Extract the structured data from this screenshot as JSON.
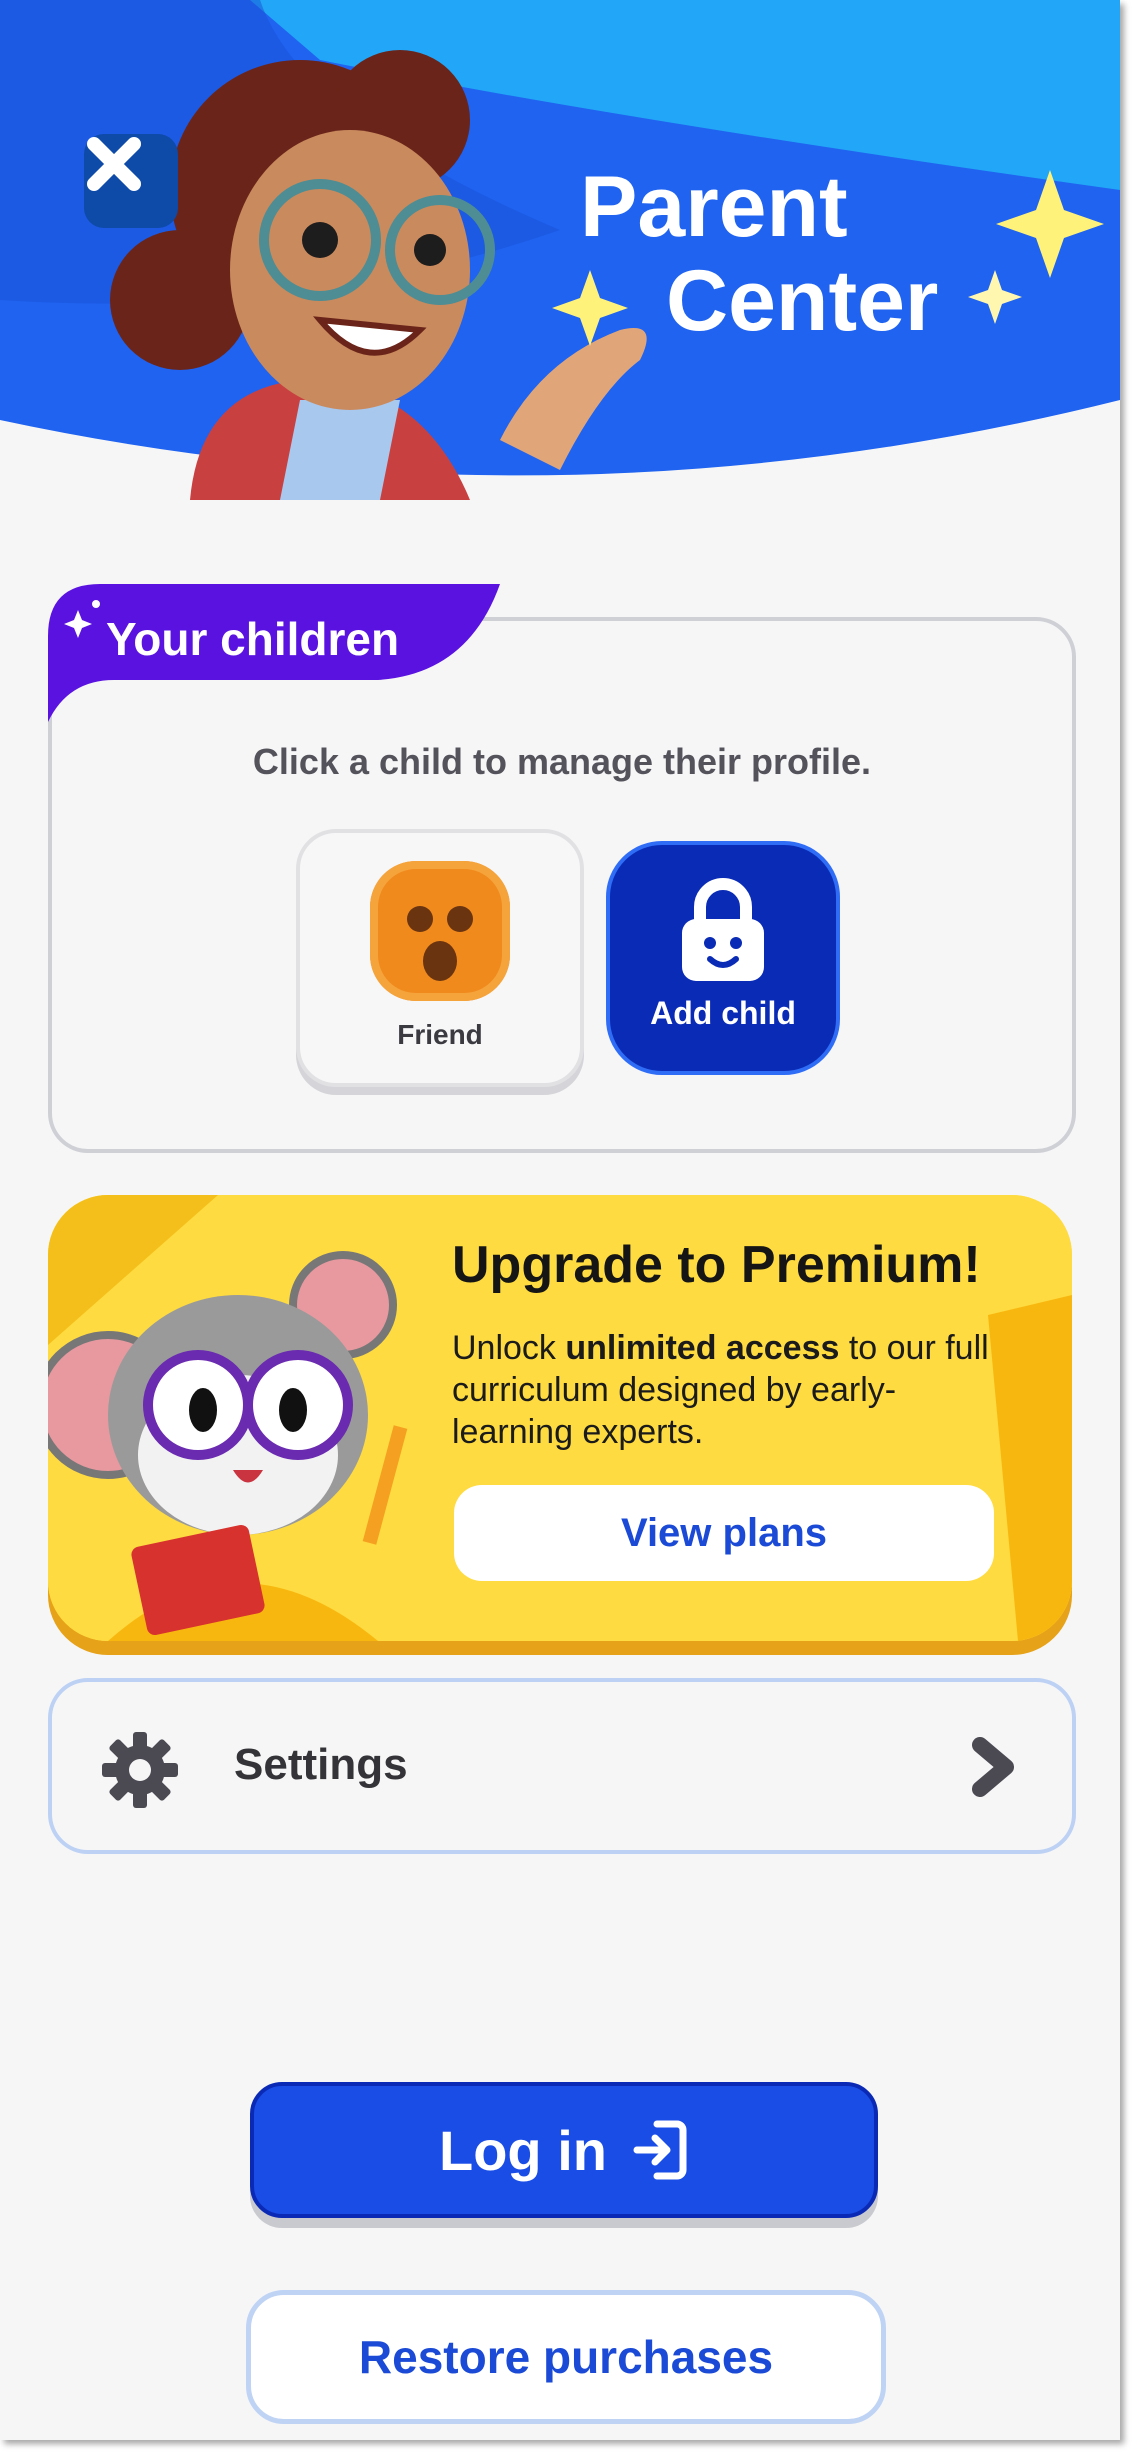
{
  "header": {
    "title_line1": "Parent",
    "title_line2": "Center",
    "close_icon": "close-icon",
    "colors": {
      "sky": "#1aa3f5",
      "blue": "#1f63f0"
    }
  },
  "children": {
    "tab_label": "Your children",
    "hint": "Click a child to manage their profile.",
    "profiles": [
      {
        "label": "Friend"
      }
    ],
    "add_child_label": "Add child",
    "colors": {
      "tab": "#5a12e0",
      "add_child": "#0a2bb5"
    }
  },
  "premium": {
    "title": "Upgrade to Premium!",
    "body_prefix": "Unlock ",
    "body_bold": "unlimited access",
    "body_suffix": " to our full curriculum designed by early-learning experts.",
    "cta_label": "View plans",
    "colors": {
      "background": "#fedb40",
      "shadow": "#e6a218"
    }
  },
  "settings": {
    "label": "Settings",
    "icon": "gear-icon",
    "chevron": "chevron-right-icon"
  },
  "actions": {
    "login_label": "Log in",
    "login_icon": "login-icon",
    "restore_label": "Restore purchases",
    "colors": {
      "login": "#1a4de6",
      "restore_text": "#1a4ad6"
    }
  }
}
